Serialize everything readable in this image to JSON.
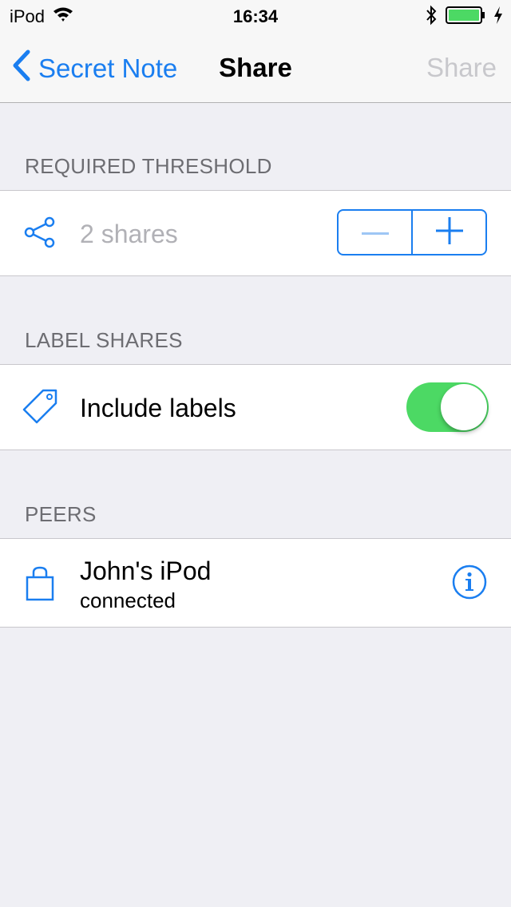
{
  "status_bar": {
    "carrier": "iPod",
    "time": "16:34",
    "icons": [
      "wifi-icon",
      "bluetooth-icon",
      "battery-icon",
      "charging-icon"
    ],
    "battery_color": "#4cd964"
  },
  "nav": {
    "back_label": "Secret Note",
    "title": "Share",
    "action_label": "Share",
    "action_enabled": false
  },
  "sections": {
    "threshold": {
      "header": "REQUIRED THRESHOLD",
      "value_text": "2 shares",
      "icon": "share-icon",
      "stepper": {
        "minus_enabled": false,
        "plus_enabled": true
      }
    },
    "labels": {
      "header": "LABEL SHARES",
      "row_label": "Include labels",
      "icon": "tag-icon",
      "toggle_on": true
    },
    "peers": {
      "header": "PEERS",
      "items": [
        {
          "name": "John's iPod",
          "status": "connected",
          "icon": "bag-icon",
          "accessory": "info-icon"
        }
      ]
    }
  },
  "colors": {
    "accent": "#1a7ef0",
    "toggle_on": "#4cd964",
    "background": "#efeff4",
    "disabled": "#c8c8cc"
  }
}
